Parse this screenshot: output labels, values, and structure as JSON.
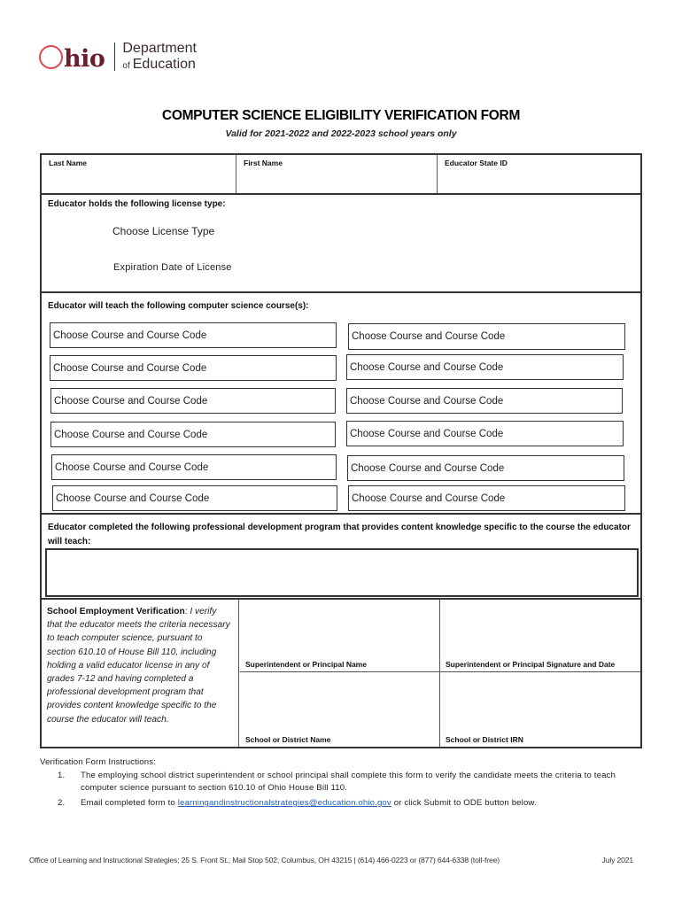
{
  "header": {
    "logo": {
      "brand": "hio",
      "brand_full": "Ohio",
      "dept_line1": "Department",
      "dept_line2_small": "of",
      "dept_line2": "Education",
      "colors": {
        "ring": "#e0474c",
        "wordmark": "#6b1e2d"
      }
    },
    "title": "COMPUTER SCIENCE ELIGIBILITY VERIFICATION FORM",
    "subtitle": "Valid for 2021-2022 and 2022-2023 school years only"
  },
  "form": {
    "names": {
      "last_name_label": "Last Name",
      "first_name_label": "First Name",
      "state_id_label": "Educator State ID",
      "last_name_value": "",
      "first_name_value": "",
      "state_id_value": ""
    },
    "license": {
      "heading": "Educator holds the following license type:",
      "type_placeholder": "Choose License Type",
      "expiration_placeholder": "Expiration Date of License"
    },
    "courses": {
      "heading": "Educator will teach the following computer science course(s):",
      "items": [
        {
          "label": "Choose Course and Course Code"
        },
        {
          "label": "Choose Course and Course Code"
        },
        {
          "label": "Choose Course and Course Code"
        },
        {
          "label": "Choose Course and Course Code"
        },
        {
          "label": "Choose Course and Course Code"
        },
        {
          "label": "Choose Course and Course Code"
        },
        {
          "label": "Choose Course and Course Code"
        },
        {
          "label": "Choose Course and Course Code"
        },
        {
          "label": "Choose Course and Course Code"
        },
        {
          "label": "Choose Course and Course Code"
        },
        {
          "label": "Choose Course and Course Code"
        },
        {
          "label": "Choose Course and Course Code"
        }
      ]
    },
    "professional_development": {
      "heading": "Educator completed the following professional development program that provides content knowledge specific to the course the educator will teach:",
      "value": ""
    },
    "verification": {
      "bold_lead": "School Employment Verification",
      "colon": ": ",
      "statement": "I verify that the educator meets the criteria necessary to teach computer science, pursuant to section 610.10 of House Bill 110, including holding a valid educator license in any of grades 7-12 and having completed a professional development program that provides content knowledge specific to the course the educator will teach.",
      "fields": {
        "principal_name_label": "Superintendent or Principal Name",
        "signature_date_label": "Superintendent or Principal Signature and Date",
        "district_name_label": "School or District Name",
        "district_irn_label": "School or District IRN"
      }
    }
  },
  "instructions": {
    "heading": "Verification Form Instructions:",
    "items": [
      {
        "number": "1.",
        "text": "The employing school district superintendent or school principal shall complete this form to verify the candidate meets the criteria to teach computer science pursuant to section 610.10 of Ohio House Bill 110."
      },
      {
        "number": "2.",
        "text_before": "Email completed form to ",
        "link": "learningandinstructionalstrategies@education.ohio.gov",
        "text_after": " or click Submit to ODE button below."
      }
    ],
    "link_color": "#1f5fbf"
  },
  "footer": {
    "address": "Office of Learning and Instructional Strategies; 25 S. Front St.; Mail Stop 502; Columbus, OH 43215 | (614) 466-0223 or (877) 644-6338 (toll-free)",
    "date": "July 2021"
  }
}
